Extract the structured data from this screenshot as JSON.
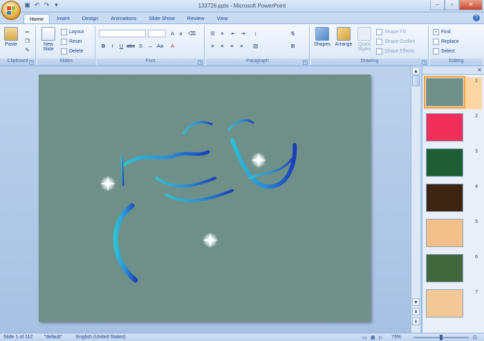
{
  "window": {
    "title": "133726.pptx - Microsoft PowerPoint"
  },
  "quick_access": [
    {
      "icon": "save-icon",
      "glyph": "▣"
    },
    {
      "icon": "undo-icon",
      "glyph": "↶"
    },
    {
      "icon": "redo-icon",
      "glyph": "↷"
    },
    {
      "icon": "customize-icon",
      "glyph": "▾"
    }
  ],
  "tabs": [
    "Home",
    "Insert",
    "Design",
    "Animations",
    "Slide Show",
    "Review",
    "View"
  ],
  "active_tab": "Home",
  "ribbon": {
    "clipboard": {
      "label": "Clipboard",
      "paste": "Paste"
    },
    "slides": {
      "label": "Slides",
      "new_slide_1": "New",
      "new_slide_2": "Slide",
      "layout": "Layout",
      "reset": "Reset",
      "delete": "Delete"
    },
    "font": {
      "label": "Font"
    },
    "paragraph": {
      "label": "Paragraph"
    },
    "drawing": {
      "label": "Drawing",
      "shapes": "Shapes",
      "arrange": "Arrange",
      "quick_styles_1": "Quick",
      "quick_styles_2": "Styles",
      "shape_fill": "Shape Fill",
      "shape_outline": "Shape Outline",
      "shape_effects": "Shape Effects"
    },
    "editing": {
      "label": "Editing",
      "find": "Find",
      "replace": "Replace",
      "select": "Select"
    }
  },
  "status": {
    "slide": "Slide 1 of 112",
    "theme": "\"default\"",
    "language": "English (United States)",
    "zoom": "73%"
  },
  "thumbnails": [
    {
      "num": "1",
      "bg": "#6f9089",
      "selected": true
    },
    {
      "num": "2",
      "bg": "#ef2f5a",
      "selected": false
    },
    {
      "num": "3",
      "bg": "#1f5e34",
      "selected": false
    },
    {
      "num": "4",
      "bg": "#3d2413",
      "selected": false
    },
    {
      "num": "5",
      "bg": "#f3c08b",
      "selected": false
    },
    {
      "num": "6",
      "bg": "#41683d",
      "selected": false
    },
    {
      "num": "7",
      "bg": "#f2c896",
      "selected": false
    }
  ],
  "colors": {
    "accent": "#15428b",
    "slide_bg": "#6f9089",
    "selection": "#f1a53b"
  }
}
